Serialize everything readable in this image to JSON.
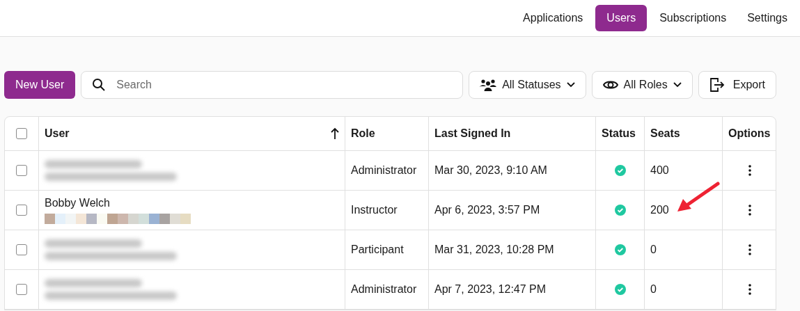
{
  "nav": {
    "tabs": [
      {
        "label": "Applications",
        "selected": false
      },
      {
        "label": "Users",
        "selected": true
      },
      {
        "label": "Subscriptions",
        "selected": false
      },
      {
        "label": "Settings",
        "selected": false
      }
    ]
  },
  "toolbar": {
    "new_button": "New User",
    "search": {
      "placeholder": "Search"
    },
    "filters": [
      {
        "kind": "statuses",
        "label": "All Statuses"
      },
      {
        "kind": "roles",
        "label": "All Roles"
      }
    ],
    "export_button": "Export"
  },
  "table": {
    "header_checkbox": {
      "checked": false
    },
    "columns": [
      {
        "label": "User",
        "sorted": true
      },
      {
        "label": "Role",
        "sorted": false
      },
      {
        "label": "Last Signed In",
        "sorted": false
      },
      {
        "label": "Status",
        "sorted": false
      },
      {
        "label": "Seats",
        "sorted": false
      },
      {
        "label": "Options",
        "sorted": false
      }
    ],
    "rows": [
      {
        "checked": false,
        "user": {
          "redacted": true
        },
        "role": "Administrator",
        "last_signed_in": "Mar 30, 2023, 9:10 AM",
        "active": true,
        "seats": "400"
      },
      {
        "checked": false,
        "user": {
          "redacted": false,
          "name": "Bobby Welch",
          "email_pixelated": true
        },
        "role": "Instructor",
        "last_signed_in": "Apr 6, 2023, 3:57 PM",
        "active": true,
        "seats": "200",
        "arrow_annotation": true
      },
      {
        "checked": false,
        "user": {
          "redacted": true
        },
        "role": "Participant",
        "last_signed_in": "Mar 31, 2023, 10:28 PM",
        "active": true,
        "seats": "0"
      },
      {
        "checked": false,
        "user": {
          "redacted": true
        },
        "role": "Administrator",
        "last_signed_in": "Apr 7, 2023, 12:47 PM",
        "active": true,
        "seats": "0"
      }
    ]
  }
}
